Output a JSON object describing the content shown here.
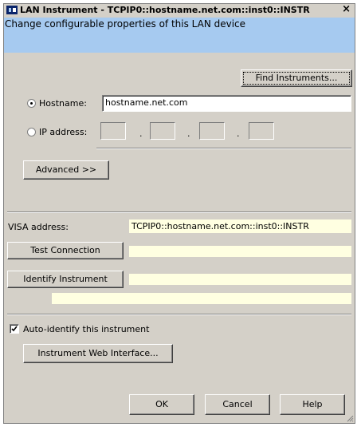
{
  "window": {
    "title": "LAN Instrument - TCPIP0::hostname.net.com::inst0::INSTR",
    "close_glyph": "×",
    "subtitle": "Change configurable properties of this LAN device"
  },
  "find_button": "Find Instruments...",
  "hostname": {
    "label": "Hostname:",
    "value": "hostname.net.com",
    "selected": true
  },
  "ip": {
    "label": "IP address:",
    "dot": ".",
    "selected": false
  },
  "advanced_button": "Advanced >>",
  "visa": {
    "label": "VISA address:",
    "value": "TCPIP0::hostname.net.com::inst0::INSTR"
  },
  "test_button": "Test Connection",
  "identify_button": "Identify Instrument",
  "auto_identify": {
    "label": "Auto-identify this instrument",
    "checked": true
  },
  "web_button": "Instrument Web Interface...",
  "ok_button": "OK",
  "cancel_button": "Cancel",
  "help_button": "Help",
  "colors": {
    "banner": "#a6caf0",
    "dialog": "#d4d0c8",
    "field_yellow": "#ffffe1"
  }
}
